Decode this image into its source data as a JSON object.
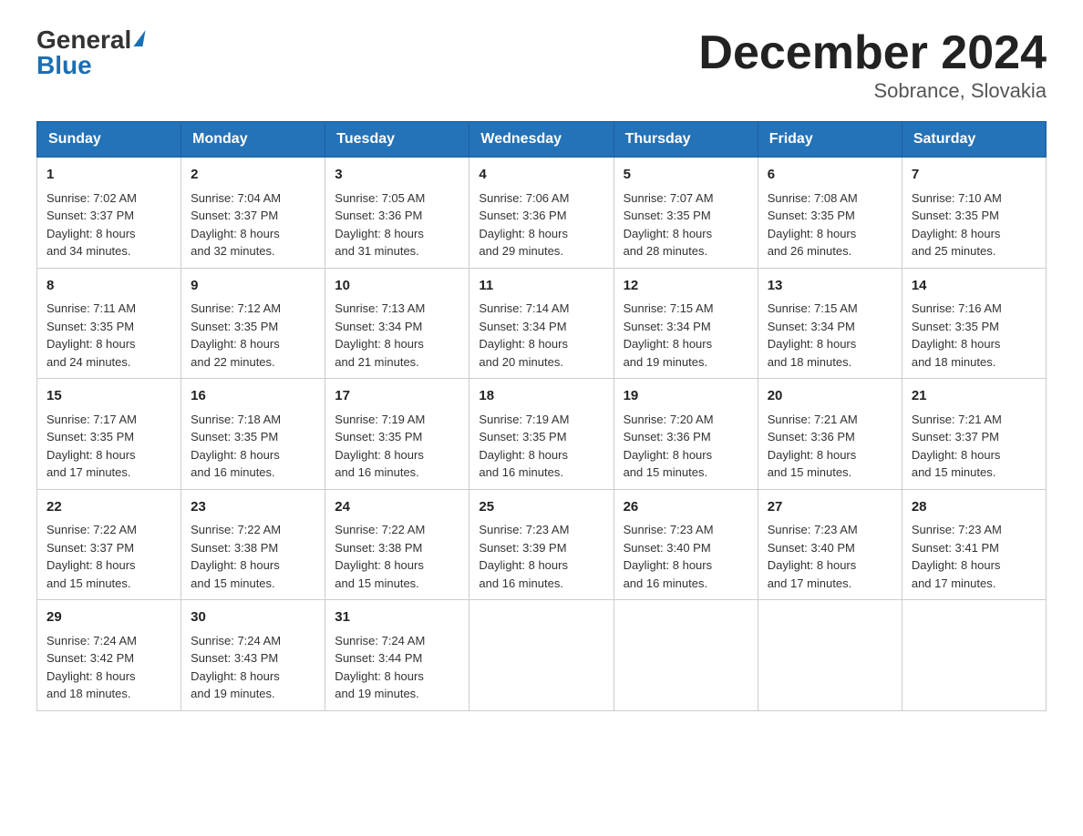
{
  "header": {
    "logo_general": "General",
    "logo_blue": "Blue",
    "month_title": "December 2024",
    "location": "Sobrance, Slovakia"
  },
  "columns": [
    "Sunday",
    "Monday",
    "Tuesday",
    "Wednesday",
    "Thursday",
    "Friday",
    "Saturday"
  ],
  "weeks": [
    [
      {
        "day": "1",
        "sunrise": "7:02 AM",
        "sunset": "3:37 PM",
        "daylight": "8 hours and 34 minutes."
      },
      {
        "day": "2",
        "sunrise": "7:04 AM",
        "sunset": "3:37 PM",
        "daylight": "8 hours and 32 minutes."
      },
      {
        "day": "3",
        "sunrise": "7:05 AM",
        "sunset": "3:36 PM",
        "daylight": "8 hours and 31 minutes."
      },
      {
        "day": "4",
        "sunrise": "7:06 AM",
        "sunset": "3:36 PM",
        "daylight": "8 hours and 29 minutes."
      },
      {
        "day": "5",
        "sunrise": "7:07 AM",
        "sunset": "3:35 PM",
        "daylight": "8 hours and 28 minutes."
      },
      {
        "day": "6",
        "sunrise": "7:08 AM",
        "sunset": "3:35 PM",
        "daylight": "8 hours and 26 minutes."
      },
      {
        "day": "7",
        "sunrise": "7:10 AM",
        "sunset": "3:35 PM",
        "daylight": "8 hours and 25 minutes."
      }
    ],
    [
      {
        "day": "8",
        "sunrise": "7:11 AM",
        "sunset": "3:35 PM",
        "daylight": "8 hours and 24 minutes."
      },
      {
        "day": "9",
        "sunrise": "7:12 AM",
        "sunset": "3:35 PM",
        "daylight": "8 hours and 22 minutes."
      },
      {
        "day": "10",
        "sunrise": "7:13 AM",
        "sunset": "3:34 PM",
        "daylight": "8 hours and 21 minutes."
      },
      {
        "day": "11",
        "sunrise": "7:14 AM",
        "sunset": "3:34 PM",
        "daylight": "8 hours and 20 minutes."
      },
      {
        "day": "12",
        "sunrise": "7:15 AM",
        "sunset": "3:34 PM",
        "daylight": "8 hours and 19 minutes."
      },
      {
        "day": "13",
        "sunrise": "7:15 AM",
        "sunset": "3:34 PM",
        "daylight": "8 hours and 18 minutes."
      },
      {
        "day": "14",
        "sunrise": "7:16 AM",
        "sunset": "3:35 PM",
        "daylight": "8 hours and 18 minutes."
      }
    ],
    [
      {
        "day": "15",
        "sunrise": "7:17 AM",
        "sunset": "3:35 PM",
        "daylight": "8 hours and 17 minutes."
      },
      {
        "day": "16",
        "sunrise": "7:18 AM",
        "sunset": "3:35 PM",
        "daylight": "8 hours and 16 minutes."
      },
      {
        "day": "17",
        "sunrise": "7:19 AM",
        "sunset": "3:35 PM",
        "daylight": "8 hours and 16 minutes."
      },
      {
        "day": "18",
        "sunrise": "7:19 AM",
        "sunset": "3:35 PM",
        "daylight": "8 hours and 16 minutes."
      },
      {
        "day": "19",
        "sunrise": "7:20 AM",
        "sunset": "3:36 PM",
        "daylight": "8 hours and 15 minutes."
      },
      {
        "day": "20",
        "sunrise": "7:21 AM",
        "sunset": "3:36 PM",
        "daylight": "8 hours and 15 minutes."
      },
      {
        "day": "21",
        "sunrise": "7:21 AM",
        "sunset": "3:37 PM",
        "daylight": "8 hours and 15 minutes."
      }
    ],
    [
      {
        "day": "22",
        "sunrise": "7:22 AM",
        "sunset": "3:37 PM",
        "daylight": "8 hours and 15 minutes."
      },
      {
        "day": "23",
        "sunrise": "7:22 AM",
        "sunset": "3:38 PM",
        "daylight": "8 hours and 15 minutes."
      },
      {
        "day": "24",
        "sunrise": "7:22 AM",
        "sunset": "3:38 PM",
        "daylight": "8 hours and 15 minutes."
      },
      {
        "day": "25",
        "sunrise": "7:23 AM",
        "sunset": "3:39 PM",
        "daylight": "8 hours and 16 minutes."
      },
      {
        "day": "26",
        "sunrise": "7:23 AM",
        "sunset": "3:40 PM",
        "daylight": "8 hours and 16 minutes."
      },
      {
        "day": "27",
        "sunrise": "7:23 AM",
        "sunset": "3:40 PM",
        "daylight": "8 hours and 17 minutes."
      },
      {
        "day": "28",
        "sunrise": "7:23 AM",
        "sunset": "3:41 PM",
        "daylight": "8 hours and 17 minutes."
      }
    ],
    [
      {
        "day": "29",
        "sunrise": "7:24 AM",
        "sunset": "3:42 PM",
        "daylight": "8 hours and 18 minutes."
      },
      {
        "day": "30",
        "sunrise": "7:24 AM",
        "sunset": "3:43 PM",
        "daylight": "8 hours and 19 minutes."
      },
      {
        "day": "31",
        "sunrise": "7:24 AM",
        "sunset": "3:44 PM",
        "daylight": "8 hours and 19 minutes."
      },
      null,
      null,
      null,
      null
    ]
  ],
  "labels": {
    "sunrise": "Sunrise:",
    "sunset": "Sunset:",
    "daylight": "Daylight:"
  }
}
